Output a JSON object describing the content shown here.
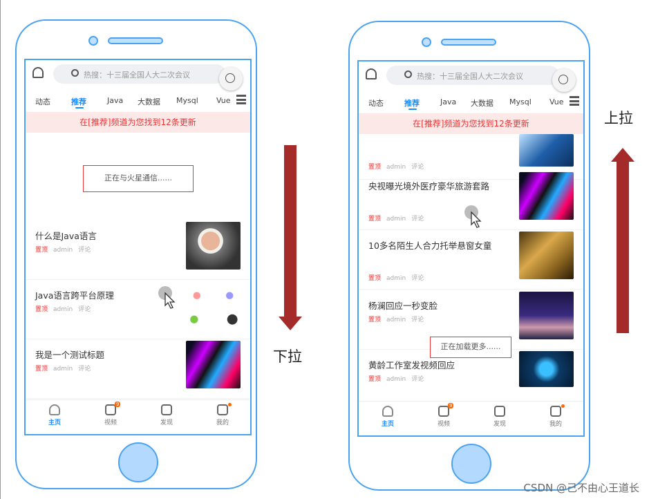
{
  "colors": {
    "accent": "#1a8cff",
    "alert": "#e33333",
    "arrow": "#a52a2a",
    "frame": "#4aa3f0"
  },
  "phones": [
    {
      "search_placeholder": "热搜：十三届全国人大二次会议",
      "tabs": [
        "动态",
        "推荐",
        "Java",
        "大数据",
        "Mysql",
        "Vue"
      ],
      "active_tab": 1,
      "banner": "在[推荐]频道为您找到12条更新",
      "loading": "正在与火星通信......",
      "articles": [
        {
          "title": "什么是Java语言",
          "top": "置顶",
          "author": "admin",
          "comment": "评论",
          "image": "portrait"
        },
        {
          "title": "Java语言跨平台原理",
          "top": "置顶",
          "author": "admin",
          "comment": "评论",
          "image": "diagram"
        },
        {
          "title": "我是一个测试标题",
          "top": "置顶",
          "author": "admin",
          "comment": "评论",
          "image": "abstract"
        }
      ]
    },
    {
      "search_placeholder": "热搜：十三届全国人大二次会议",
      "tabs": [
        "动态",
        "推荐",
        "Java",
        "大数据",
        "Mysql",
        "Vue"
      ],
      "active_tab": 1,
      "banner": "在[推荐]频道为您找到12条更新",
      "loading": "正在加载更多......",
      "articles": [
        {
          "title": "",
          "top": "置顶",
          "author": "admin",
          "comment": "评论",
          "image": "building"
        },
        {
          "title": "央视曝光境外医疗豪华旅游套路",
          "top": "置顶",
          "author": "admin",
          "comment": "评论",
          "image": "abstract"
        },
        {
          "title": "10多名陌生人合力托举悬窗女童",
          "top": "置顶",
          "author": "admin",
          "comment": "评论",
          "image": "gold"
        },
        {
          "title": "杨澜回应一秒变脸",
          "top": "置顶",
          "author": "admin",
          "comment": "评论",
          "image": "city"
        },
        {
          "title": "黄龄工作室发视频回应",
          "top": "置顶",
          "author": "admin",
          "comment": "评论",
          "image": "chip"
        }
      ]
    }
  ],
  "tabbar": [
    {
      "label": "主页",
      "icon": "home-icon",
      "badge": ""
    },
    {
      "label": "视频",
      "icon": "video-icon",
      "badge": "9"
    },
    {
      "label": "发现",
      "icon": "discover-icon",
      "badge": ""
    },
    {
      "label": "我的",
      "icon": "user-icon",
      "badge": "dot"
    }
  ],
  "labels": {
    "pull_down": "下拉",
    "pull_up": "上拉"
  },
  "watermark": "CSDN @己不由心王道长"
}
